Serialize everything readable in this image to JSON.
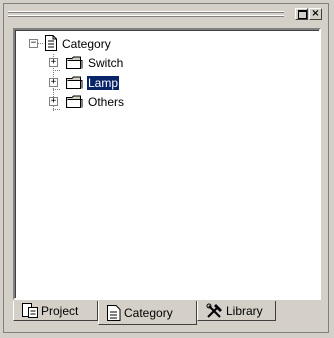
{
  "tree": {
    "root": {
      "label": "Category",
      "icon": "document-icon",
      "expanded": true
    },
    "children": [
      {
        "label": "Switch",
        "icon": "folder-icon",
        "selected": false
      },
      {
        "label": "Lamp",
        "icon": "folder-icon",
        "selected": true
      },
      {
        "label": "Others",
        "icon": "folder-icon",
        "selected": false
      }
    ]
  },
  "tabs": [
    {
      "label": "Project",
      "icon": "project-icon",
      "active": false
    },
    {
      "label": "Category",
      "icon": "category-icon",
      "active": true
    },
    {
      "label": "Library",
      "icon": "tools-icon",
      "active": false
    }
  ],
  "titlebar": {
    "maximize_icon": "maximize-icon",
    "close_label": "×"
  },
  "colors": {
    "face": "#d4d0c8",
    "selection": "#0a246a",
    "shadow": "#808080"
  }
}
